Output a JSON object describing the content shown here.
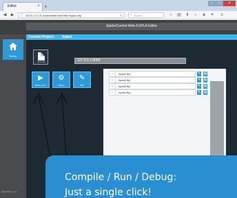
{
  "browser": {
    "tab_title": "Editor",
    "tab_close": "×",
    "new_tab": "+",
    "url": "192.5.172.15 /control/edit.html?file=fupla1.fbp",
    "search_placeholder": "Suche",
    "window_min": "–",
    "window_max": "□",
    "window_close": "×"
  },
  "app": {
    "title": "SpiderControl Web-FUPLA Editor",
    "project_label": "Current Project:",
    "project_name": "fupla1",
    "home_label": "Home",
    "new_file_label": "New File",
    "ip_value": "127.0.0.1:8080",
    "version": "SW-BUILD 1.2.3"
  },
  "actions": [
    {
      "label": "Build & Run",
      "icon": "play-icon",
      "glyph": "▶"
    },
    {
      "label": "Debug",
      "icon": "gear-icon",
      "glyph": "⚙"
    },
    {
      "label": "Edit",
      "icon": "edit-icon",
      "glyph": "✎"
    }
  ],
  "files": [
    {
      "no": "1",
      "name": "fupla1.fbp"
    },
    {
      "no": "2",
      "name": "fupla2.fbp"
    },
    {
      "no": "3",
      "name": "fupla3.fbp"
    },
    {
      "no": "4",
      "name": "fupla4.fbp"
    }
  ],
  "row_edit_glyph": "✎",
  "row_open_glyph": "▤",
  "caption": {
    "line1": "Compile / Run / Debug:",
    "line2": "Just a single click!"
  },
  "colors": {
    "accent": "#2f9ad8",
    "header": "#3e3f42",
    "project_bar": "#3db6f0",
    "panel": "#1e2a33",
    "caption_bg": "#2a8fd0"
  }
}
